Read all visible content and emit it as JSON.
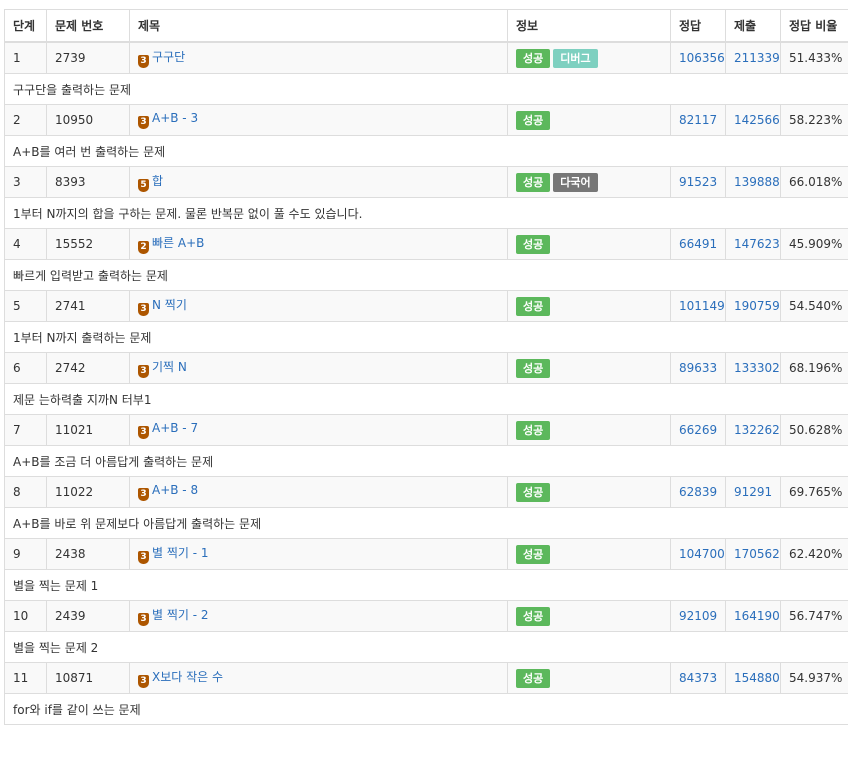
{
  "headers": {
    "level": "단계",
    "id": "문제 번호",
    "title": "제목",
    "info": "정보",
    "accepted": "정답",
    "submissions": "제출",
    "ratio": "정답 비율"
  },
  "problems": [
    {
      "level": "1",
      "id": "2739",
      "tier": "3",
      "title": "구구단",
      "badges": [
        "성공",
        "디버그"
      ],
      "badge_kinds": [
        "success",
        "debug"
      ],
      "accepted": "106356",
      "submissions": "211339",
      "ratio": "51.433%",
      "desc": "구구단을 출력하는 문제"
    },
    {
      "level": "2",
      "id": "10950",
      "tier": "3",
      "title": "A+B - 3",
      "badges": [
        "성공"
      ],
      "badge_kinds": [
        "success"
      ],
      "accepted": "82117",
      "submissions": "142566",
      "ratio": "58.223%",
      "desc": "A+B를 여러 번 출력하는 문제"
    },
    {
      "level": "3",
      "id": "8393",
      "tier": "5",
      "title": "합",
      "badges": [
        "성공",
        "다국어"
      ],
      "badge_kinds": [
        "success",
        "multi"
      ],
      "accepted": "91523",
      "submissions": "139888",
      "ratio": "66.018%",
      "desc": "1부터 N까지의 합을 구하는 문제. 물론 반복문 없이 풀 수도 있습니다."
    },
    {
      "level": "4",
      "id": "15552",
      "tier": "2",
      "title": "빠른 A+B",
      "badges": [
        "성공"
      ],
      "badge_kinds": [
        "success"
      ],
      "accepted": "66491",
      "submissions": "147623",
      "ratio": "45.909%",
      "desc": "빠르게 입력받고 출력하는 문제"
    },
    {
      "level": "5",
      "id": "2741",
      "tier": "3",
      "title": "N 찍기",
      "badges": [
        "성공"
      ],
      "badge_kinds": [
        "success"
      ],
      "accepted": "101149",
      "submissions": "190759",
      "ratio": "54.540%",
      "desc": "1부터 N까지 출력하는 문제"
    },
    {
      "level": "6",
      "id": "2742",
      "tier": "3",
      "title": "기찍 N",
      "badges": [
        "성공"
      ],
      "badge_kinds": [
        "success"
      ],
      "accepted": "89633",
      "submissions": "133302",
      "ratio": "68.196%",
      "desc": "제문 는하력출 지까N 터부1"
    },
    {
      "level": "7",
      "id": "11021",
      "tier": "3",
      "title": "A+B - 7",
      "badges": [
        "성공"
      ],
      "badge_kinds": [
        "success"
      ],
      "accepted": "66269",
      "submissions": "132262",
      "ratio": "50.628%",
      "desc": "A+B를 조금 더 아름답게 출력하는 문제"
    },
    {
      "level": "8",
      "id": "11022",
      "tier": "3",
      "title": "A+B - 8",
      "badges": [
        "성공"
      ],
      "badge_kinds": [
        "success"
      ],
      "accepted": "62839",
      "submissions": "91291",
      "ratio": "69.765%",
      "desc": "A+B를 바로 위 문제보다 아름답게 출력하는 문제"
    },
    {
      "level": "9",
      "id": "2438",
      "tier": "3",
      "title": "별 찍기 - 1",
      "badges": [
        "성공"
      ],
      "badge_kinds": [
        "success"
      ],
      "accepted": "104700",
      "submissions": "170562",
      "ratio": "62.420%",
      "desc": "별을 찍는 문제 1"
    },
    {
      "level": "10",
      "id": "2439",
      "tier": "3",
      "title": "별 찍기 - 2",
      "badges": [
        "성공"
      ],
      "badge_kinds": [
        "success"
      ],
      "accepted": "92109",
      "submissions": "164190",
      "ratio": "56.747%",
      "desc": "별을 찍는 문제 2"
    },
    {
      "level": "11",
      "id": "10871",
      "tier": "3",
      "title": "X보다 작은 수",
      "badges": [
        "성공"
      ],
      "badge_kinds": [
        "success"
      ],
      "accepted": "84373",
      "submissions": "154880",
      "ratio": "54.937%",
      "desc": "for와 if를 같이 쓰는 문제"
    }
  ],
  "colors": {
    "link": "#2a6ebb",
    "tier_bronze": "#ad5600",
    "badge_success": "#5cb85c",
    "badge_debug": "#7ed0c0",
    "badge_multi": "#777777",
    "row_alt": "#f9f9f9",
    "border": "#dddddd"
  }
}
